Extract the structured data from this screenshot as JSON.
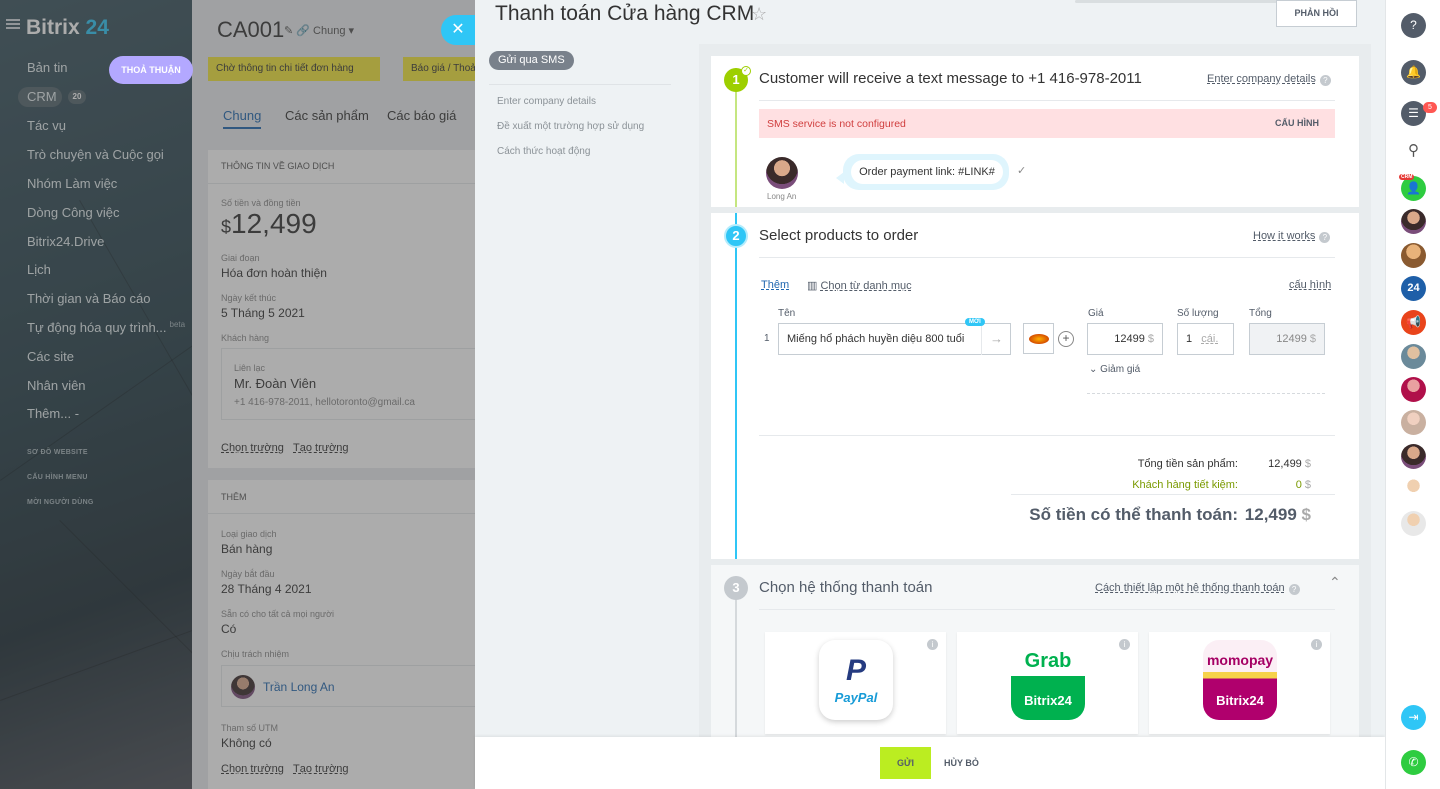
{
  "leftnav": {
    "logo_main": "Bitrix",
    "logo_num": "24",
    "items": [
      "Bản tin",
      "CRM",
      "Tác vụ",
      "Trò chuyện và Cuộc gọi",
      "Nhóm Làm việc",
      "Dòng Công việc",
      "Bitrix24.Drive",
      "Lịch",
      "Thời gian và Báo cáo",
      "Tự động hóa quy trình...",
      "Các site",
      "Nhân viên",
      "Thêm..."
    ],
    "crm_count": "20",
    "beta": "beta",
    "more_suffix": "-",
    "small_items": [
      "SƠ ĐỒ WEBSITE",
      "CẤU HÌNH MENU",
      "MỜI NGƯỜI DÙNG"
    ]
  },
  "deal": {
    "id": "CA001",
    "category": "Chung",
    "thoa_thuan": "THOẢ THUẬN",
    "pipeline": [
      "Chờ thông tin chi tiết đơn hàng",
      "Báo giá / Thoả"
    ],
    "tabs": [
      "Chung",
      "Các sản phẩm",
      "Các báo giá"
    ],
    "section_info": "THÔNG TIN VỀ GIAO DỊCH",
    "amount_label": "Số tiền và đồng tiền",
    "amount_currency": "$",
    "amount_value": "12,499",
    "stage_label": "Giai đoạn",
    "stage_value": "Hóa đơn hoàn thiện",
    "end_label": "Ngày kết thúc",
    "end_value": "5 Tháng 5 2021",
    "customer_label": "Khách hàng",
    "contact_label": "Liên lạc",
    "contact_name": "Mr. Đoàn Viên",
    "contact_info": "+1 416-978-2011, hellotoronto@gmail.ca",
    "choose_field": "Chọn trường",
    "create_field": "Tạo trường",
    "section_more": "THÊM",
    "type_label": "Loại giao dịch",
    "type_value": "Bán hàng",
    "start_label": "Ngày bắt đầu",
    "start_value": "28 Tháng 4 2021",
    "avail_label": "Sẵn có cho tất cả mọi người",
    "avail_value": "Có",
    "resp_label": "Chịu trách nhiệm",
    "resp_value": "Trần Long An",
    "utm_label": "Tham số UTM",
    "utm_value": "Không có"
  },
  "slider": {
    "title": "Thanh toán Cửa hàng CRM",
    "feedback": "PHẢN HỒI",
    "sms_badge": "Gửi qua SMS",
    "side_links": [
      "Enter company details",
      "Đề xuất một trường hợp sử dụng",
      "Cách thức hoạt động"
    ],
    "step1": {
      "num": "1",
      "heading": "Customer will receive a text message to +1 416-978-2011",
      "hint": "Enter company details",
      "error": "SMS service is not configured",
      "configure": "CẤU HÌNH",
      "avatar_name": "Long An",
      "message": "Order payment link: #LINK#"
    },
    "step2": {
      "num": "2",
      "heading": "Select products to order",
      "hint": "How it works",
      "add": "Thêm",
      "catalog": "Chọn từ danh mục",
      "settings": "cấu hình",
      "col_name": "Tên",
      "col_price": "Giá",
      "col_qty": "Số lượng",
      "col_total": "Tổng",
      "row_index": "1",
      "new_badge": "MỚI",
      "product_name": "Miếng hổ phách huyền diệu 800 tuổi",
      "price": "12499",
      "currency": "$",
      "qty": "1",
      "unit": "cái.",
      "total": "12499",
      "discount": "Giảm giá",
      "sum_label": "Tổng tiền sản phẩm:",
      "sum_value": "12,499",
      "save_label": "Khách hàng tiết kiệm:",
      "save_value": "0",
      "pay_label": "Số tiền có thể thanh toán:",
      "pay_value": "12,499"
    },
    "step3": {
      "num": "3",
      "heading": "Chọn hệ thống thanh toán",
      "hint": "Cách thiết lập một hệ thống thanh toán",
      "providers": [
        {
          "name": "PayPal",
          "line2": ""
        },
        {
          "name": "Grab",
          "line2": "Bitrix24"
        },
        {
          "name": "momopay",
          "line2": "Bitrix24"
        }
      ]
    }
  },
  "footer": {
    "send": "GỬI",
    "cancel": "HỦY BỎ"
  },
  "rightbar": {
    "notif_count": "5",
    "crm_badge": "CRM",
    "bitrix_num": "24"
  },
  "colors": {
    "accent": "#2fc6f6",
    "send_btn": "#bbed21",
    "step_green": "#9dcf00",
    "error_bg": "#ffe0e2",
    "error_text": "#d03e3e"
  }
}
